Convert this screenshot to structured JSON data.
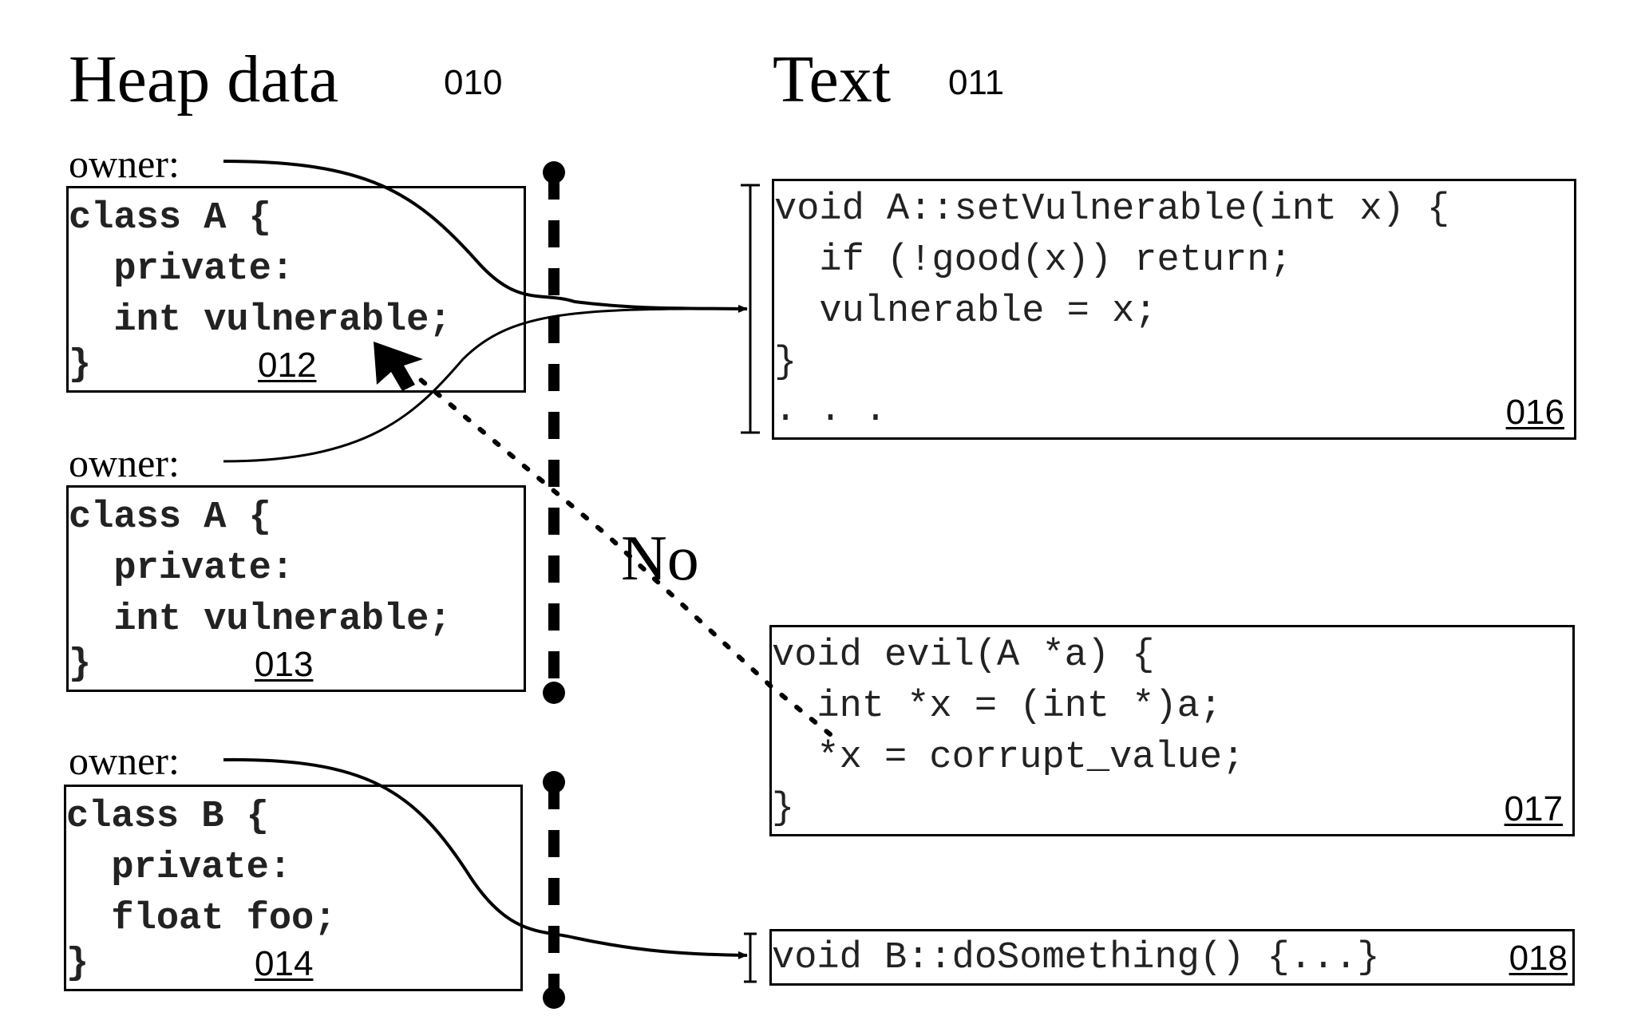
{
  "headings": {
    "heap": {
      "label": "Heap data",
      "ref": "010"
    },
    "text": {
      "label": "Text",
      "ref": "011"
    }
  },
  "owner_label": "owner:",
  "heap_objects": [
    {
      "ref": "012",
      "lines": [
        "class A {",
        "  private:",
        "  int vulnerable;",
        "}"
      ]
    },
    {
      "ref": "013",
      "lines": [
        "class A {",
        "  private:",
        "  int vulnerable;",
        "}"
      ]
    },
    {
      "ref": "014",
      "lines": [
        "class B {",
        "  private:",
        "  float foo;",
        "}"
      ]
    }
  ],
  "text_blocks": [
    {
      "ref": "016",
      "lines": [
        "void A::setVulnerable(int x) {",
        "  if (!good(x)) return;",
        "  vulnerable = x;",
        "}",
        ". . ."
      ]
    },
    {
      "ref": "017",
      "lines": [
        "void evil(A *a) {",
        "  int *x = (int *)a;",
        "  *x = corrupt_value;",
        "}"
      ]
    },
    {
      "ref": "018",
      "lines": [
        "void B::doSomething() {...}"
      ]
    }
  ],
  "denied_access_label": "No",
  "connections": [
    {
      "from": "012",
      "to": "016",
      "kind": "owner-pointer"
    },
    {
      "from": "013",
      "to": "016",
      "kind": "owner-pointer"
    },
    {
      "from": "014",
      "to": "018",
      "kind": "owner-pointer"
    },
    {
      "from": "017",
      "to": "012",
      "kind": "denied-write",
      "label": "No"
    }
  ]
}
